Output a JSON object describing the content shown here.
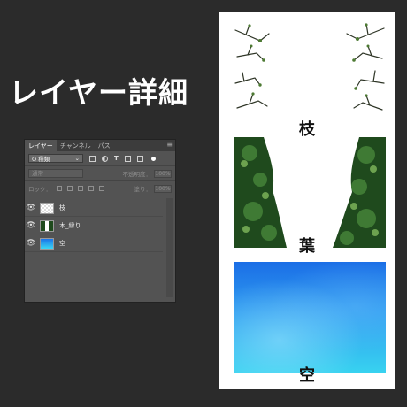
{
  "title": "レイヤー詳細",
  "panel": {
    "tabs": [
      "レイヤー",
      "チャンネル",
      "パス"
    ],
    "menu_icon": "panel-menu-icon",
    "filter_label": "Q 種類",
    "blend_mode": "通常",
    "opacity_label": "不透明度：",
    "opacity_value": "100%",
    "lock_label": "ロック：",
    "fill_label": "塗り：",
    "fill_value": "100%",
    "layers": [
      {
        "name": "枝",
        "visible": true
      },
      {
        "name": "木_縁り",
        "visible": true
      },
      {
        "name": "空",
        "visible": true
      }
    ]
  },
  "previews": {
    "branch_label": "枝",
    "leaf_label": "葉",
    "sky_label": "空"
  },
  "colors": {
    "background": "#2b2b2b",
    "panel": "#535353",
    "sky_top": "#1b6ee6",
    "sky_bottom": "#38d3f0",
    "foliage": "#1f4a1d"
  }
}
